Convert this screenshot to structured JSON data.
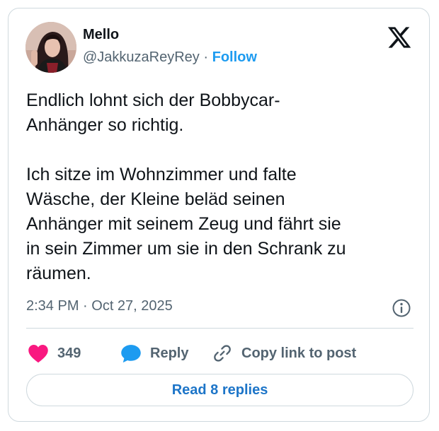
{
  "author": {
    "name": "Mello",
    "handle": "@JakkuzaReyRey",
    "separator": "·",
    "follow_label": "Follow",
    "avatar_icon": "profile-photo"
  },
  "platform_icon": "x-logo-icon",
  "tweet": {
    "text": "Endlich lohnt sich der Bobbycar-\nAnhänger so richtig.\n\nIch sitze im Wohnzimmer und falte\nWäsche, der Kleine beläd seinen\nAnhänger mit seinem Zeug und fährt sie\nin sein Zimmer um sie in den Schrank zu\nräumen.",
    "timestamp": "2:34 PM · Oct 27, 2025"
  },
  "actions": {
    "likes_count": "349",
    "reply_label": "Reply",
    "copy_link_label": "Copy link to post"
  },
  "read_replies_label": "Read 8 replies",
  "colors": {
    "accent": "#1d9bf0",
    "like": "#f91880",
    "reply_bubble": "#1d9bf0",
    "text_primary": "#0f1419",
    "text_secondary": "#536471",
    "border": "#cfd9de"
  }
}
